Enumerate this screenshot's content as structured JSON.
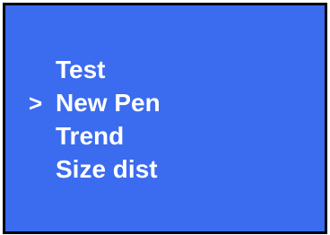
{
  "menu": {
    "cursor": ">",
    "selected_index": 1,
    "items": [
      {
        "label": "Test"
      },
      {
        "label": "New Pen"
      },
      {
        "label": "Trend"
      },
      {
        "label": "Size dist"
      }
    ]
  },
  "colors": {
    "background": "#3b6bef",
    "text": "#ffffff",
    "border": "#000000"
  }
}
